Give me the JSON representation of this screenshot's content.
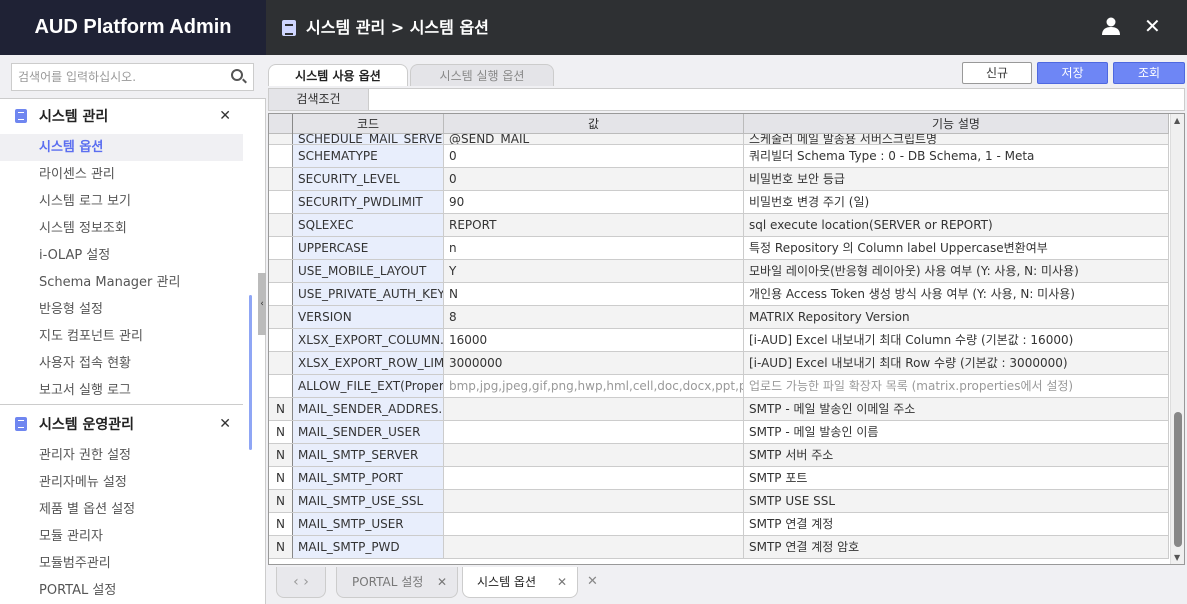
{
  "app": {
    "brand": "AUD Platform Admin",
    "title": "시스템 관리 > 시스템 옵션"
  },
  "sidebar": {
    "search_placeholder": "검색어를 입력하십시오.",
    "groups": [
      {
        "label": "시스템 관리",
        "items": [
          "시스템 옵션",
          "라이센스 관리",
          "시스템 로그 보기",
          "시스템 정보조회",
          "i-OLAP 설정",
          "Schema Manager 관리",
          "반응형 설정",
          "지도 컴포넌트 관리",
          "사용자 접속 현황",
          "보고서 실행 로그"
        ]
      },
      {
        "label": "시스템 운영관리",
        "items": [
          "관리자 권한 설정",
          "관리자메뉴 설정",
          "제품 별 옵션 설정",
          "모듈 관리자",
          "모듈범주관리",
          "PORTAL 설정"
        ]
      }
    ]
  },
  "tabs": [
    "시스템 사용 옵션",
    "시스템 실행 옵션"
  ],
  "buttons": {
    "new": "신규",
    "save": "저장",
    "search": "조회"
  },
  "filter": {
    "label": "검색조건",
    "value": ""
  },
  "grid": {
    "headers": [
      "",
      "코드",
      "값",
      "기능 설명"
    ],
    "rows": [
      [
        "",
        "SCHEDULE_MAIL_SERVE...",
        "@SEND_MAIL",
        "스케줄러 메일 발송용 서버스크립트명"
      ],
      [
        "",
        "SCHEMATYPE",
        "0",
        "쿼리빌더 Schema Type : 0 - DB Schema, 1 - Meta"
      ],
      [
        "",
        "SECURITY_LEVEL",
        "0",
        "비밀번호 보안 등급"
      ],
      [
        "",
        "SECURITY_PWDLIMIT",
        "90",
        "비밀번호 변경 주기 (일)"
      ],
      [
        "",
        "SQLEXEC",
        "REPORT",
        "sql execute location(SERVER or REPORT)"
      ],
      [
        "",
        "UPPERCASE",
        "n",
        "특정 Repository 의 Column label Uppercase변환여부"
      ],
      [
        "",
        "USE_MOBILE_LAYOUT",
        "Y",
        "모바일 레이아웃(반응형 레이아웃) 사용 여부 (Y: 사용, N: 미사용)"
      ],
      [
        "",
        "USE_PRIVATE_AUTH_KEY",
        "N",
        "개인용 Access Token 생성 방식 사용 여부 (Y: 사용, N: 미사용)"
      ],
      [
        "",
        "VERSION",
        "8",
        "MATRIX Repository Version"
      ],
      [
        "",
        "XLSX_EXPORT_COLUMN...",
        "16000",
        "[i-AUD] Excel 내보내기 최대 Column 수량 (기본값 : 16000)"
      ],
      [
        "",
        "XLSX_EXPORT_ROW_LIMIT",
        "3000000",
        "[i-AUD] Excel 내보내기 최대 Row 수량 (기본값 : 3000000)"
      ],
      [
        "",
        "ALLOW_FILE_EXT(Propert...",
        "bmp,jpg,jpeg,gif,png,hwp,hml,cell,doc,docx,ppt,pptx,...",
        "업로드 가능한 파일 확장자 목록 (matrix.properties에서 설정)"
      ],
      [
        "N",
        "MAIL_SENDER_ADDRES...",
        "",
        "SMTP - 메일 발송인 이메일 주소"
      ],
      [
        "N",
        "MAIL_SENDER_USER",
        "",
        "SMTP - 메일 발송인 이름"
      ],
      [
        "N",
        "MAIL_SMTP_SERVER",
        "",
        "SMTP 서버 주소"
      ],
      [
        "N",
        "MAIL_SMTP_PORT",
        "",
        "SMTP 포트"
      ],
      [
        "N",
        "MAIL_SMTP_USE_SSL",
        "",
        "SMTP USE SSL"
      ],
      [
        "N",
        "MAIL_SMTP_USER",
        "",
        "SMTP 연결 계정"
      ],
      [
        "N",
        "MAIL_SMTP_PWD",
        "",
        "SMTP 연결 계정 암호"
      ]
    ]
  },
  "bottom_tabs": [
    "PORTAL 설정",
    "시스템 옵션"
  ]
}
